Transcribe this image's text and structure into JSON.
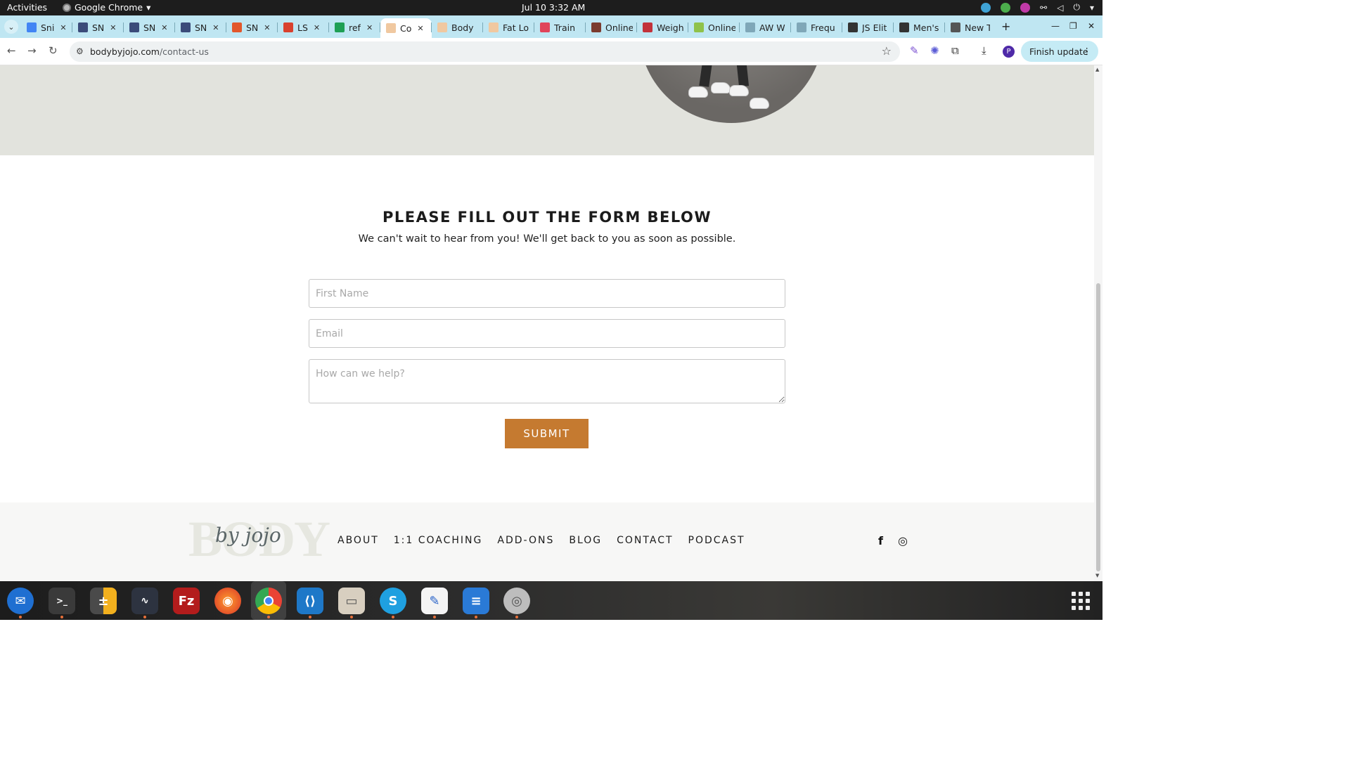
{
  "system_bar": {
    "activities": "Activities",
    "app_name": "Google Chrome",
    "clock": "Jul 10  3:32 AM"
  },
  "browser": {
    "tabs": [
      {
        "label": "Sni",
        "favicon_color": "#4285f4",
        "active": false
      },
      {
        "label": "SN",
        "favicon_color": "#3b4b7a",
        "active": false
      },
      {
        "label": "SN",
        "favicon_color": "#3b4b7a",
        "active": false
      },
      {
        "label": "SN",
        "favicon_color": "#3b4b7a",
        "active": false
      },
      {
        "label": "SN",
        "favicon_color": "#e2572b",
        "active": false
      },
      {
        "label": "LS",
        "favicon_color": "#d9412e",
        "active": false
      },
      {
        "label": "ref",
        "favicon_color": "#1e9f54",
        "active": false
      },
      {
        "label": "Co",
        "favicon_color": "#f0c8a0",
        "active": true
      },
      {
        "label": "Body",
        "favicon_color": "#f0c8a0",
        "active": false
      },
      {
        "label": "Fat Lo",
        "favicon_color": "#f0c8a0",
        "active": false
      },
      {
        "label": "Train",
        "favicon_color": "#e0445a",
        "active": false
      },
      {
        "label": "Online",
        "favicon_color": "#7a3b2e",
        "active": false
      },
      {
        "label": "Weigh",
        "favicon_color": "#c2323a",
        "active": false
      },
      {
        "label": "Online",
        "favicon_color": "#8fc24a",
        "active": false
      },
      {
        "label": "AW W",
        "favicon_color": "#7fa7b8",
        "active": false
      },
      {
        "label": "Frequ",
        "favicon_color": "#7fa7b8",
        "active": false
      },
      {
        "label": "JS Elit",
        "favicon_color": "#333333",
        "active": false
      },
      {
        "label": "Men's",
        "favicon_color": "#333333",
        "active": false
      },
      {
        "label": "New T",
        "favicon_color": "#555555",
        "active": false
      }
    ],
    "url_domain": "bodybyjojo.com",
    "url_path": "/contact-us",
    "finish_update": "Finish update",
    "profile_initial": "P"
  },
  "page": {
    "form_title": "PLEASE FILL OUT THE FORM BELOW",
    "form_subtitle": "We can't wait to hear from you! We'll get back to you as soon as possible.",
    "first_name_placeholder": "First Name",
    "email_placeholder": "Email",
    "message_placeholder": "How can we help?",
    "submit_label": "SUBMIT",
    "accent_color": "#c57a30"
  },
  "footer": {
    "logo_body": "BODY",
    "logo_script": "by jojo",
    "nav": {
      "about": "ABOUT",
      "coaching": "1:1 COACHING",
      "addons": "ADD-ONS",
      "blog": "BLOG",
      "contact": "CONTACT",
      "podcast": "PODCAST"
    },
    "social_icons": [
      "facebook-icon",
      "instagram-icon"
    ]
  },
  "dock": {
    "apps": [
      "thunderbird",
      "terminal",
      "calculator",
      "system-monitor",
      "filezilla",
      "firefox",
      "chrome",
      "vscode",
      "files",
      "skype",
      "text-editor",
      "libreoffice-writer",
      "disks"
    ]
  }
}
